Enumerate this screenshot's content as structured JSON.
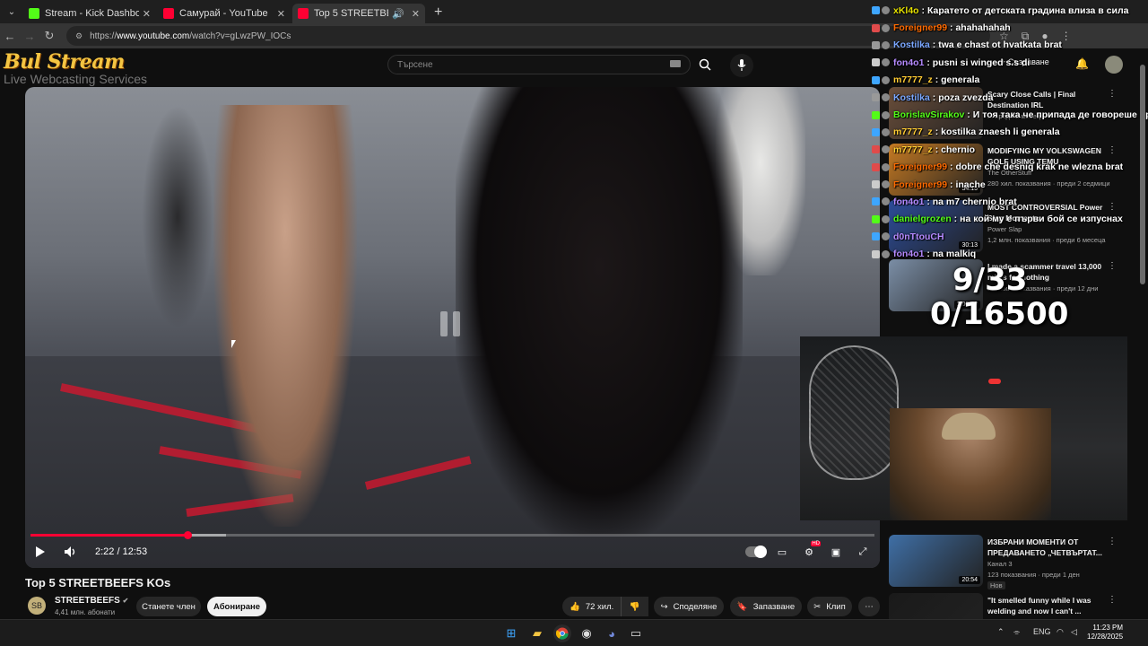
{
  "browser": {
    "tabs": [
      {
        "title": "Stream - Kick Dashboard",
        "favicon_color": "#53fc18"
      },
      {
        "title": "Самурай - YouTube",
        "favicon_color": "#ff0033"
      },
      {
        "title": "Top 5 STREETBEEFS KOs - Y",
        "favicon_color": "#ff0033"
      }
    ],
    "new_tab": "+",
    "address_prefix": "https://",
    "address_host": "www.youtube.com",
    "address_path": "/watch?v=gLwzPW_IOCs"
  },
  "youtube": {
    "search_placeholder": "Търсене",
    "create_label": "Създаване",
    "video": {
      "time": "2:22 / 12:53",
      "played_fraction": 0.186,
      "buffered_fraction": 0.232
    },
    "title": "Top 5 STREETBEEFS KOs",
    "channel": {
      "name": "STREETBEEFS",
      "subs": "4,41 млн. абонати",
      "member_label": "Станете член",
      "subscribe_label": "Абониране"
    },
    "actions": {
      "likes": "72 хил.",
      "share": "Споделяне",
      "save": "Запазване",
      "clip": "Клип"
    },
    "recommendations": [
      {
        "title": "Scary Close Calls | Final Destination IRL",
        "channel": "",
        "meta": "... преди 2 месеца",
        "thumb": "#6a4e3a"
      },
      {
        "title": "MODIFYING MY VOLKSWAGEN GOLF USING TEMU",
        "channel": "The OtherStuff",
        "meta": "280 хил. показвания · преди 2 седмици",
        "duration": "34:15",
        "thumb": "#c67a22"
      },
      {
        "title": "MOST CONTROVERSIAL Power Slap Moments",
        "channel": "Power Slap",
        "meta": "1,2 млн. показвания · преди 6 месеца",
        "duration": "30:13",
        "thumb": "#2c4c9a"
      },
      {
        "title": "I made a scammer travel 13,000 miles for nothing",
        "channel": "",
        "meta": "366 хил. показвания · преди 12 дни",
        "duration": "1:06:48",
        "thumb": "#7b8ea6"
      },
      {
        "title": "ИЗБРАНИ МОМЕНТИ ОТ ПРЕДАВАНЕТО „ЧЕТВЪРТАТ...",
        "channel": "Канал 3",
        "meta": "123 показвания · преди 1 ден",
        "badge": "Нов",
        "duration": "20:54",
        "thumb": "#3f6fa6"
      },
      {
        "title": "\"It smelled funny while I was welding and now I can't ...",
        "channel": "",
        "meta": "",
        "thumb": "#1a1a1a"
      }
    ]
  },
  "stream_overlay": {
    "logo_main": "Bul Stream",
    "logo_sub": "Live Webcasting Services",
    "counter_line1": "9/33",
    "counter_line2": "0/16500",
    "chat": [
      {
        "nick": "xKl4o",
        "color": "#e5e000",
        "text": "Каратето от детската градина влиза в сила",
        "badge": "#3ea6ff"
      },
      {
        "nick": "Foreigner99",
        "color": "#ff6a00",
        "text": "ahahahahah",
        "badge": "#e04b4b"
      },
      {
        "nick": "Kostilka",
        "color": "#7aa7ff",
        "text": "twa e chast ot hvatkata brat",
        "badge": "#999999"
      },
      {
        "nick": "fon4o1",
        "color": "#b58aff",
        "text": "pusni si winged s.s di",
        "badge": "#cccccc"
      },
      {
        "nick": "m7777_z",
        "color": "#ffcc33",
        "text": "generala",
        "badge": "#3ea6ff"
      },
      {
        "nick": "Kostilka",
        "color": "#7aa7ff",
        "text": "poza zvezda",
        "badge": "#999999"
      },
      {
        "nick": "BorislavSirakov",
        "color": "#53fc18",
        "text": "И тоя така че припада де говореше пр",
        "badge": "#53fc18"
      },
      {
        "nick": "m7777_z",
        "color": "#ffcc33",
        "text": "kostilka znaesh li generala",
        "badge": "#3ea6ff"
      },
      {
        "nick": "m7777_z",
        "color": "#ffcc33",
        "text": "chernio",
        "badge": "#e04b4b"
      },
      {
        "nick": "Foreigner99",
        "color": "#ff6a00",
        "text": "dobre che desniq krak ne wlezna brat",
        "badge": "#e04b4b"
      },
      {
        "nick": "Foreigner99",
        "color": "#ff6a00",
        "text": "inache",
        "badge": "#cccccc"
      },
      {
        "nick": "fon4o1",
        "color": "#b58aff",
        "text": "na m7 chernio brat",
        "badge": "#3ea6ff"
      },
      {
        "nick": "danielgrozen",
        "color": "#53fc18",
        "text": "на кой му е първи бой се изпуснах",
        "badge": "#53fc18"
      },
      {
        "nick": "d0nTtouCH",
        "color": "#b58aff",
        "text": "",
        "badge": "#3ea6ff"
      },
      {
        "nick": "fon4o1",
        "color": "#b58aff",
        "text": "na malkiq",
        "badge": "#cccccc"
      }
    ]
  },
  "taskbar": {
    "lang": "ENG",
    "time": "11:23 PM",
    "date": "12/28/2025"
  },
  "colors": {
    "accent": "#ff0033",
    "background": "#0f0f0f"
  }
}
